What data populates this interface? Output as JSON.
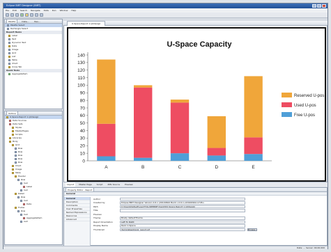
{
  "window": {
    "title": "Eclipse BIRT Designer (BIRT)"
  },
  "menu": [
    "File",
    "Edit",
    "Search",
    "Navigate",
    "Data",
    "Run",
    "Window",
    "Help"
  ],
  "palette": {
    "tabs": [
      "Palette",
      "Data...",
      "Res..."
    ],
    "sections": [
      "Report Items",
      "Quick Tools"
    ],
    "report_items": [
      "Label",
      "Text",
      "Dynamic Text",
      "Data",
      "Image",
      "Grid",
      "List",
      "Table",
      "Chart",
      "Cross Tab"
    ],
    "quick_tools": [
      "AggregateItem"
    ],
    "buttons": [
      "Palette Select",
      "Rectangle Select"
    ]
  },
  "outline": {
    "tab": "Outline",
    "items": [
      "U-Space Report 1.rptdesign",
      "Data Sources",
      "Data Sets",
      "Styles",
      "MasterPages",
      "Scripts",
      "Libraries",
      "Body",
      "Grid",
      "Row",
      "Row",
      "Row",
      "Row",
      "Row",
      "Chart",
      "Image",
      "Table",
      "Header",
      "Row",
      "Cell",
      "Label",
      "Cell",
      "Detail",
      "Row",
      "Cell",
      "Data",
      "Footer",
      "Row",
      "Cell",
      "AggregateItem",
      "Cell"
    ]
  },
  "editor": {
    "tab": "U-Space Report 1.rptdesign",
    "bottom_tabs": [
      "Layout",
      "Master Page",
      "Script",
      "XML Source",
      "Preview"
    ]
  },
  "chart_data": {
    "type": "bar",
    "stacked": true,
    "title": "U-Space Capacity",
    "categories": [
      "A",
      "B",
      "C",
      "D",
      "E"
    ],
    "series": [
      {
        "name": "Free U-pos",
        "values": [
          6,
          4,
          10,
          7,
          9
        ],
        "color": "#4f9fd8"
      },
      {
        "name": "Used U-pos",
        "values": [
          43,
          93,
          67,
          10,
          22
        ],
        "color": "#ee4d62"
      },
      {
        "name": "Reserved U-pos",
        "values": [
          85,
          3,
          4,
          42,
          81
        ],
        "color": "#f0a63a"
      }
    ],
    "yticks": [
      0,
      10,
      20,
      30,
      40,
      50,
      60,
      70,
      80,
      90,
      100,
      110,
      120,
      130,
      140
    ],
    "ylim": [
      0,
      140
    ],
    "grid": false,
    "legend": "right"
  },
  "properties": {
    "tab": "Property Editor - Report",
    "section": "General",
    "nav": [
      "General",
      "Description",
      "Comments",
      "User Properties",
      "Named Expressions",
      "Resources",
      "Advanced"
    ],
    "fields": [
      {
        "label": "Author",
        "value": ""
      },
      {
        "label": "Created by",
        "value": "Eclipse BIRT Designer Version 2.6.x (20100622 Build <2.6.1.v20100902-1745>"
      },
      {
        "label": "Path",
        "value": "C:\\Users\\Default\\user\\TCG-NM\\BIRT\\Insight\\U-Space Report 1.rptdesign"
      },
      {
        "label": "Title",
        "value": ""
      },
      {
        "label": "Preview",
        "value": ""
      },
      {
        "label": "Theme",
        "value": "Birety defaultTheme"
      },
      {
        "label": "Report Orientation",
        "value": "Left To Right"
      },
      {
        "label": "Display Name",
        "value": "Rack U-Space"
      },
      {
        "label": "Thumbnail",
        "value": "/templates/blank_report.gif"
      }
    ],
    "browse_label": "Browse..."
  },
  "status": "Date: ...  Server: 00.00.000"
}
